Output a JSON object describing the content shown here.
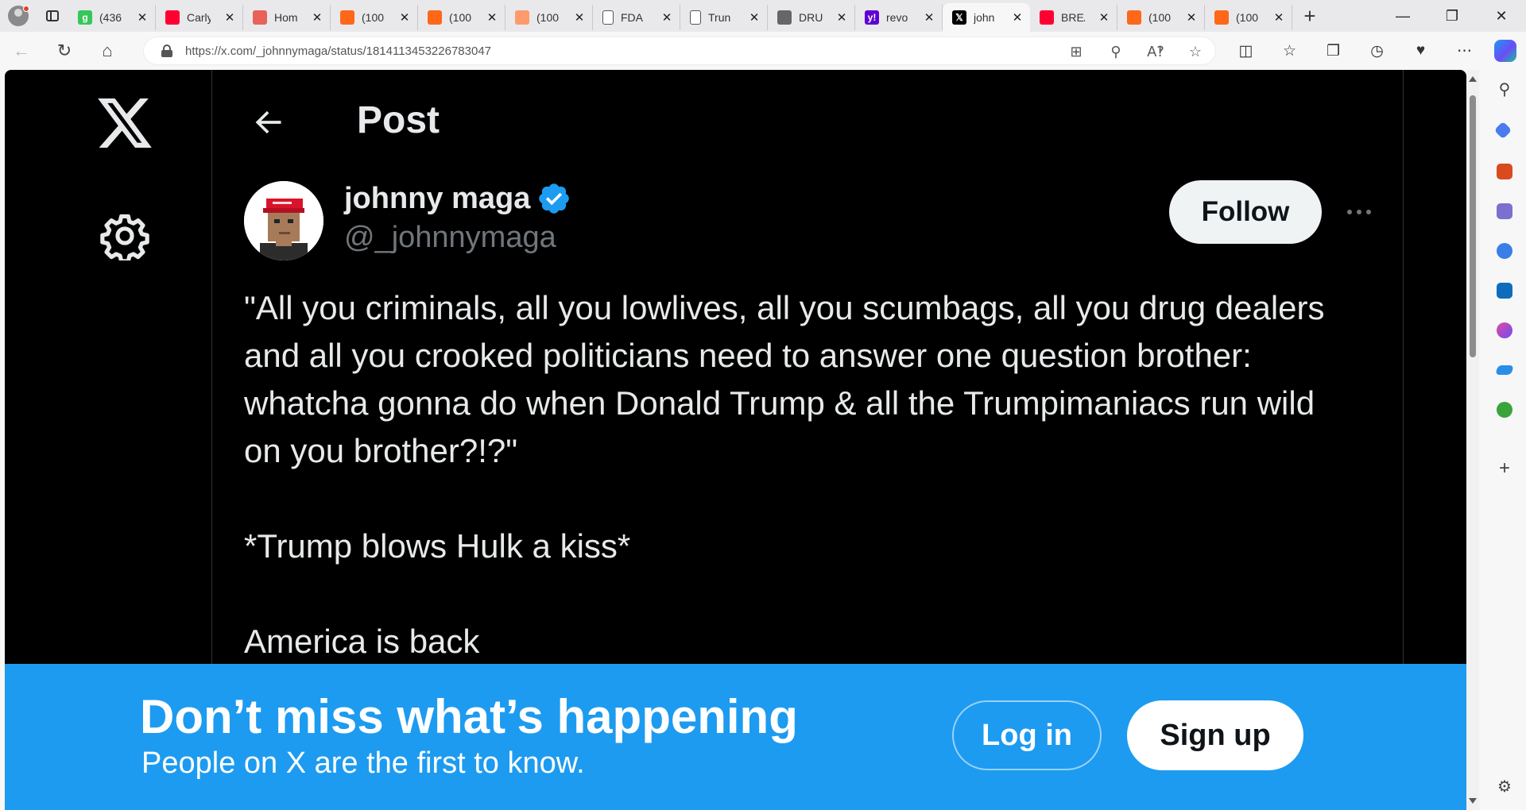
{
  "browser": {
    "tabs": [
      {
        "title": "(436",
        "favicon": "g",
        "color": "#35c759"
      },
      {
        "title": "Carly",
        "favicon": "youtube-icon",
        "color": "#ff0033"
      },
      {
        "title": "Hom",
        "favicon": "profile-icon",
        "color": "#e8625a"
      },
      {
        "title": "(100",
        "favicon": "substack-icon",
        "color": "#ff6719"
      },
      {
        "title": "(100",
        "favicon": "substack-icon",
        "color": "#ff6719"
      },
      {
        "title": "(100",
        "favicon": "substack-icon",
        "color": "#ff9a6b"
      },
      {
        "title": "FDA",
        "favicon": "page-icon",
        "color": "#ffffff"
      },
      {
        "title": "Trun",
        "favicon": "page-icon",
        "color": "#ffffff"
      },
      {
        "title": "DRU",
        "favicon": "dr-icon",
        "color": "#666666"
      },
      {
        "title": "revo",
        "favicon": "y!",
        "color": "#6001d2"
      },
      {
        "title": "john",
        "favicon": "x-icon",
        "color": "#000000"
      },
      {
        "title": "BREA",
        "favicon": "youtube-icon",
        "color": "#ff0033"
      },
      {
        "title": "(100",
        "favicon": "substack-icon",
        "color": "#ff6719"
      },
      {
        "title": "(100",
        "favicon": "substack-icon",
        "color": "#ff6719"
      }
    ],
    "active_tab_index": 10,
    "url": "https://x.com/_johnnymaga/status/1814113453226783047"
  },
  "page": {
    "header_title": "Post",
    "author": {
      "display_name": "johnny maga",
      "handle": "@_johnnymaga",
      "verified": true
    },
    "follow_label": "Follow",
    "post_paragraphs": [
      "\"All you criminals, all you lowlives, all you scumbags, all you drug dealers and all you crooked politicians need to answer one question brother: whatcha gonna do when Donald Trump & all the Trumpimaniacs run wild on you brother?!?\"",
      "*Trump blows Hulk a kiss*",
      "America is back"
    ]
  },
  "banner": {
    "title": "Don’t miss what’s happening",
    "subtitle": "People on X are the first to know.",
    "login_label": "Log in",
    "signup_label": "Sign up"
  },
  "colors": {
    "x_blue": "#1d9bf0",
    "verified_blue": "#1d9bf0",
    "text_primary": "#e7e9ea",
    "text_secondary": "#71767b"
  }
}
